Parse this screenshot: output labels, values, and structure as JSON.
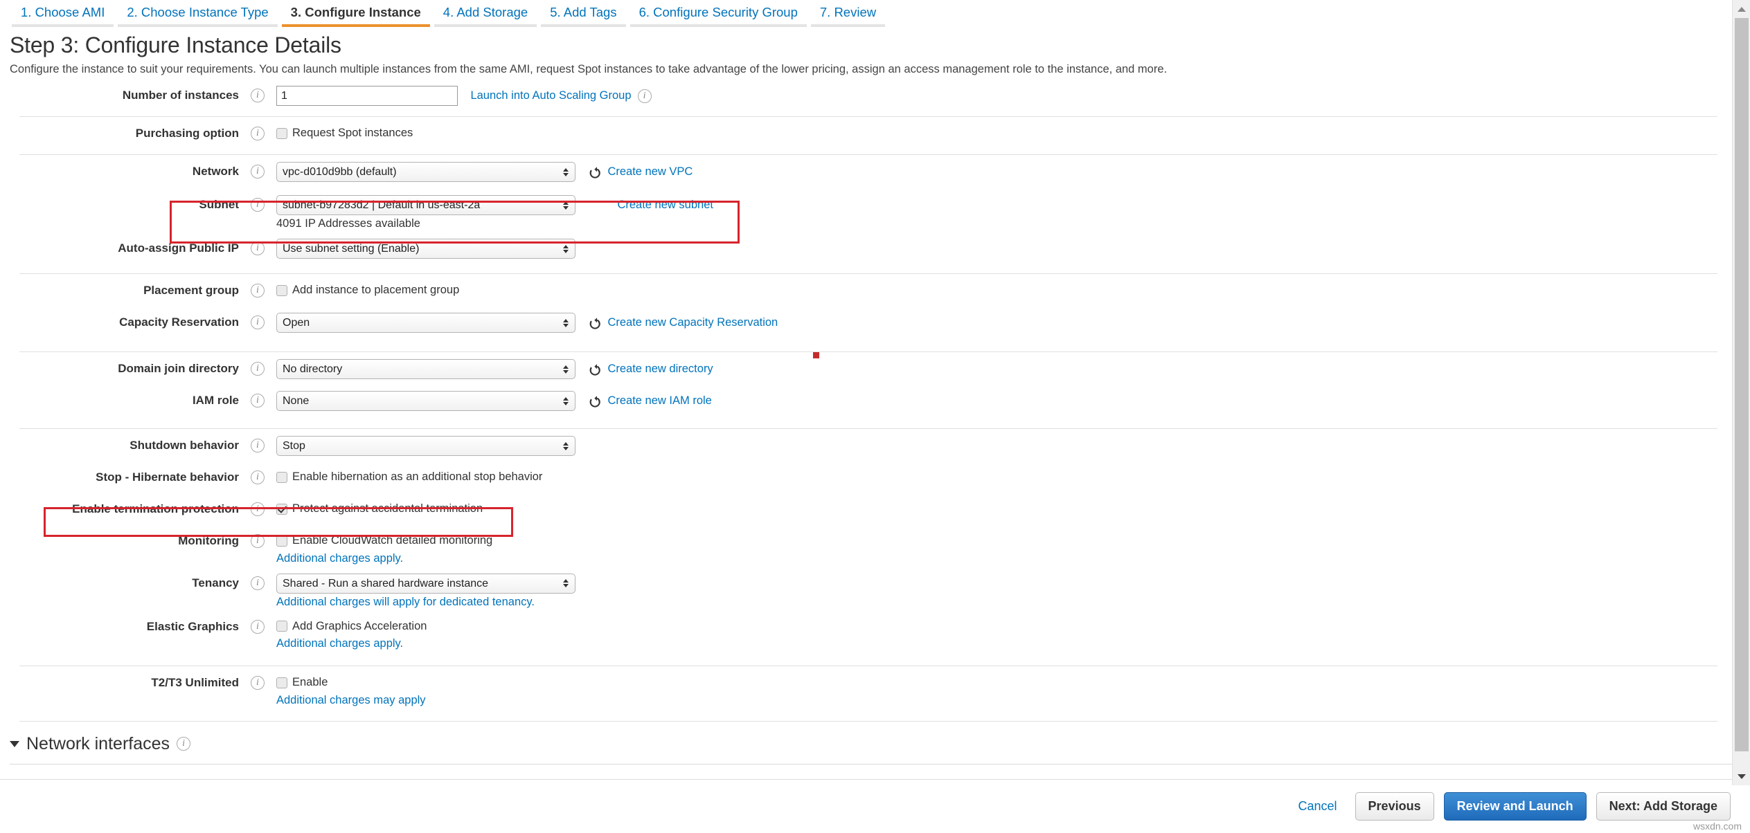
{
  "wizard": {
    "tabs": [
      {
        "label": "1. Choose AMI",
        "active": false
      },
      {
        "label": "2. Choose Instance Type",
        "active": false
      },
      {
        "label": "3. Configure Instance",
        "active": true
      },
      {
        "label": "4. Add Storage",
        "active": false
      },
      {
        "label": "5. Add Tags",
        "active": false
      },
      {
        "label": "6. Configure Security Group",
        "active": false
      },
      {
        "label": "7. Review",
        "active": false
      }
    ]
  },
  "header": {
    "title": "Step 3: Configure Instance Details",
    "subtitle": "Configure the instance to suit your requirements. You can launch multiple instances from the same AMI, request Spot instances to take advantage of the lower pricing, assign an access management role to the instance, and more."
  },
  "form": {
    "number_of_instances": {
      "label": "Number of instances",
      "value": "1",
      "link": "Launch into Auto Scaling Group"
    },
    "purchasing_option": {
      "label": "Purchasing option",
      "checkbox_label": "Request Spot instances",
      "checked": false
    },
    "network": {
      "label": "Network",
      "value": "vpc-d010d9bb (default)",
      "link": "Create new VPC"
    },
    "subnet": {
      "label": "Subnet",
      "value": "subnet-b97283d2 | Default in us-east-2a",
      "link": "Create new subnet",
      "note": "4091 IP Addresses available"
    },
    "auto_assign_public_ip": {
      "label": "Auto-assign Public IP",
      "value": "Use subnet setting (Enable)"
    },
    "placement_group": {
      "label": "Placement group",
      "checkbox_label": "Add instance to placement group",
      "checked": false
    },
    "capacity_reservation": {
      "label": "Capacity Reservation",
      "value": "Open",
      "link": "Create new Capacity Reservation"
    },
    "domain_join_directory": {
      "label": "Domain join directory",
      "value": "No directory",
      "link": "Create new directory"
    },
    "iam_role": {
      "label": "IAM role",
      "value": "None",
      "link": "Create new IAM role"
    },
    "shutdown_behavior": {
      "label": "Shutdown behavior",
      "value": "Stop"
    },
    "stop_hibernate_behavior": {
      "label": "Stop - Hibernate behavior",
      "checkbox_label": "Enable hibernation as an additional stop behavior",
      "checked": false
    },
    "termination_protection": {
      "label": "Enable termination protection",
      "checkbox_label": "Protect against accidental termination",
      "checked": true
    },
    "monitoring": {
      "label": "Monitoring",
      "checkbox_label": "Enable CloudWatch detailed monitoring",
      "checked": false,
      "note_link": "Additional charges apply."
    },
    "tenancy": {
      "label": "Tenancy",
      "value": "Shared - Run a shared hardware instance",
      "note_link": "Additional charges will apply for dedicated tenancy."
    },
    "elastic_graphics": {
      "label": "Elastic Graphics",
      "checkbox_label": "Add Graphics Acceleration",
      "checked": false,
      "note_link": "Additional charges apply."
    },
    "t2_t3_unlimited": {
      "label": "T2/T3 Unlimited",
      "checkbox_label": "Enable",
      "checked": false,
      "note_link": "Additional charges may apply"
    }
  },
  "network_interfaces": {
    "title": "Network interfaces"
  },
  "footer": {
    "cancel": "Cancel",
    "previous": "Previous",
    "review_and_launch": "Review and Launch",
    "next": "Next: Add Storage"
  },
  "watermark": "wsxdn.com",
  "colors": {
    "accent_orange": "#ec912d",
    "link_blue": "#0073bb",
    "primary_button": "#1f6bbb",
    "highlight_red": "#d6242c"
  }
}
